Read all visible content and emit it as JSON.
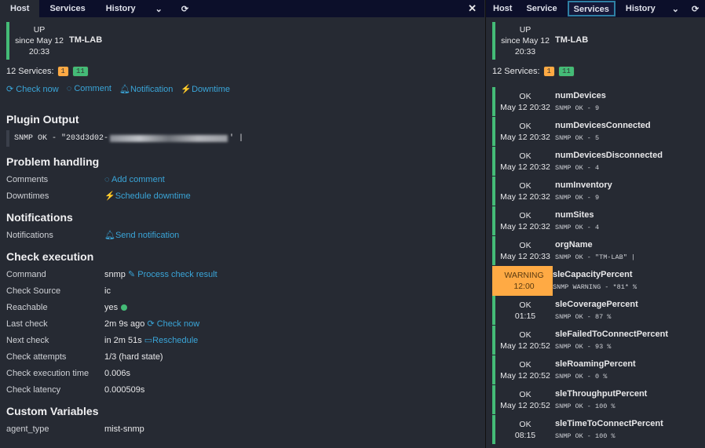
{
  "left": {
    "tabs": [
      "Host",
      "Services",
      "History"
    ],
    "close": "✕",
    "host": {
      "state": "UP",
      "since": "since May 12",
      "time": "20:33",
      "name": "TM-LAB"
    },
    "services_label": "12 Services:",
    "warn_count": "1",
    "ok_count": "11",
    "actions": [
      "Check now",
      "Comment",
      "Notification",
      "Downtime"
    ],
    "plugin_title": "Plugin Output",
    "plugin_prefix": "SNMP OK - \"203d3d02-",
    "plugin_suffix": "' |",
    "problem_title": "Problem handling",
    "comments_label": "Comments",
    "add_comment": "Add comment",
    "downtimes_label": "Downtimes",
    "schedule_downtime": "Schedule downtime",
    "notifications_title": "Notifications",
    "notifications_label": "Notifications",
    "send_notification": "Send notification",
    "check_title": "Check execution",
    "command_label": "Command",
    "command": "snmp",
    "process_check": "Process check result",
    "source_label": "Check Source",
    "source": "ic",
    "reachable_label": "Reachable",
    "reachable": "yes",
    "last_label": "Last check",
    "last": "2m 9s ago",
    "check_now": "Check now",
    "next_label": "Next check",
    "next": "in 2m 51s",
    "reschedule": "Reschedule",
    "attempts_label": "Check attempts",
    "attempts": "1/3 (hard state)",
    "exec_label": "Check execution time",
    "exec": "0.006s",
    "latency_label": "Check latency",
    "latency": "0.000509s",
    "custom_title": "Custom Variables",
    "agent_label": "agent_type",
    "agent": "mist-snmp"
  },
  "right": {
    "tabs": [
      "Host",
      "Service",
      "Services",
      "History"
    ],
    "host": {
      "state": "UP",
      "since": "since May 12",
      "time": "20:33",
      "name": "TM-LAB"
    },
    "services_label": "12 Services:",
    "warn_count": "1",
    "ok_count": "11",
    "services": [
      {
        "state": "OK",
        "time": "May 12 20:32",
        "name": "numDevices",
        "output": "SNMP OK - 9",
        "status": "ok"
      },
      {
        "state": "OK",
        "time": "May 12 20:32",
        "name": "numDevicesConnected",
        "output": "SNMP OK - 5",
        "status": "ok"
      },
      {
        "state": "OK",
        "time": "May 12 20:32",
        "name": "numDevicesDisconnected",
        "output": "SNMP OK - 4",
        "status": "ok"
      },
      {
        "state": "OK",
        "time": "May 12 20:32",
        "name": "numInventory",
        "output": "SNMP OK - 9",
        "status": "ok"
      },
      {
        "state": "OK",
        "time": "May 12 20:32",
        "name": "numSites",
        "output": "SNMP OK - 4",
        "status": "ok"
      },
      {
        "state": "OK",
        "time": "May 12 20:33",
        "name": "orgName",
        "output": "SNMP OK - \"TM-LAB\" |",
        "status": "ok"
      },
      {
        "state": "WARNING",
        "time": "12:00",
        "name": "sleCapacityPercent",
        "output": "SNMP WARNING - *81* %",
        "status": "warn"
      },
      {
        "state": "OK",
        "time": "01:15",
        "name": "sleCoveragePercent",
        "output": "SNMP OK - 87 %",
        "status": "ok"
      },
      {
        "state": "OK",
        "time": "May 12 20:52",
        "name": "sleFailedToConnectPercent",
        "output": "SNMP OK - 93 %",
        "status": "ok"
      },
      {
        "state": "OK",
        "time": "May 12 20:52",
        "name": "sleRoamingPercent",
        "output": "SNMP OK - 0 %",
        "status": "ok"
      },
      {
        "state": "OK",
        "time": "May 12 20:52",
        "name": "sleThroughputPercent",
        "output": "SNMP OK - 100 %",
        "status": "ok"
      },
      {
        "state": "OK",
        "time": "08:15",
        "name": "sleTimeToConnectPercent",
        "output": "SNMP OK - 100 %",
        "status": "ok"
      }
    ]
  }
}
